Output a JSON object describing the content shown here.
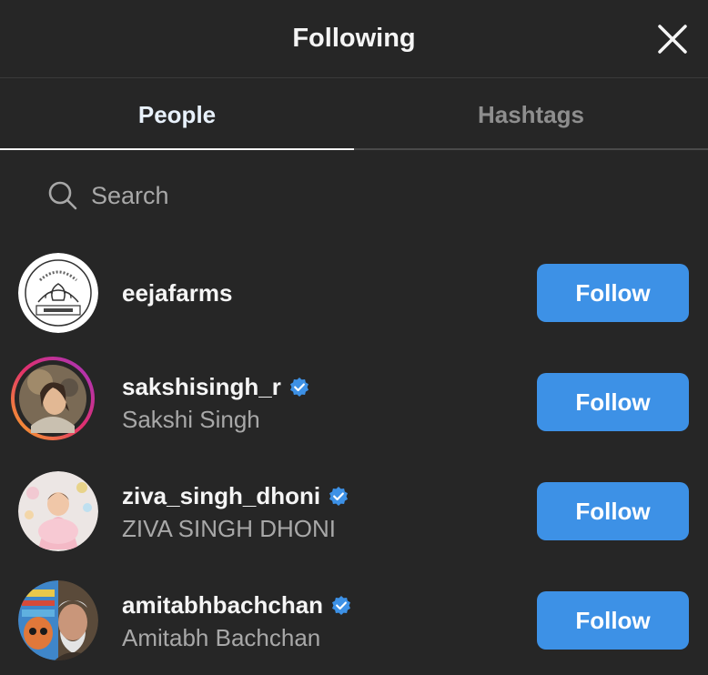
{
  "header": {
    "title": "Following",
    "close_icon": "close-icon"
  },
  "tabs": [
    {
      "label": "People",
      "active": true
    },
    {
      "label": "Hashtags",
      "active": false
    }
  ],
  "search": {
    "placeholder": "Search",
    "value": "",
    "icon": "search-icon"
  },
  "accounts": [
    {
      "username": "eejafarms",
      "full_name": "",
      "verified": false,
      "button": "Follow",
      "avatar_logo_text": "GROWING WITH LOVE · EEJA FARMS"
    },
    {
      "username": "sakshisingh_r",
      "full_name": "Sakshi Singh",
      "verified": true,
      "button": "Follow",
      "has_story_ring": true
    },
    {
      "username": "ziva_singh_dhoni",
      "full_name": "ZIVA SINGH DHONI",
      "verified": true,
      "button": "Follow"
    },
    {
      "username": "amitabhbachchan",
      "full_name": "Amitabh Bachchan",
      "verified": true,
      "button": "Follow"
    }
  ],
  "colors": {
    "background": "#262626",
    "follow_button": "#3d91e6",
    "verified_badge": "#3d91e6",
    "secondary_text": "#a8a8a8"
  }
}
